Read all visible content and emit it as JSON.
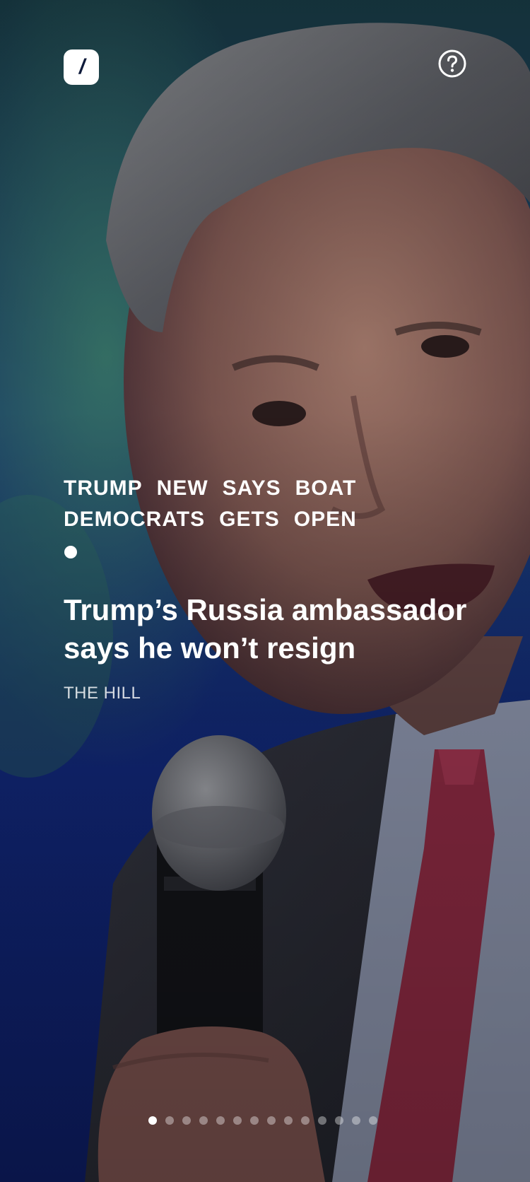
{
  "header": {
    "logo_glyph": "/",
    "help_icon": "question-circle-icon"
  },
  "story": {
    "tags": [
      "TRUMP",
      "NEW",
      "SAYS",
      "BOAT",
      "DEMOCRATS",
      "GETS",
      "OPEN"
    ],
    "headline": "Trump’s Russia ambassador says he won’t resign",
    "source": "THE HILL"
  },
  "pager": {
    "total": 14,
    "active_index": 0
  },
  "colors": {
    "text": "#ffffff",
    "logo_bg": "#ffffff",
    "logo_fg": "#0e1a3a",
    "pager_inactive": "rgba(255,255,255,0.38)"
  }
}
